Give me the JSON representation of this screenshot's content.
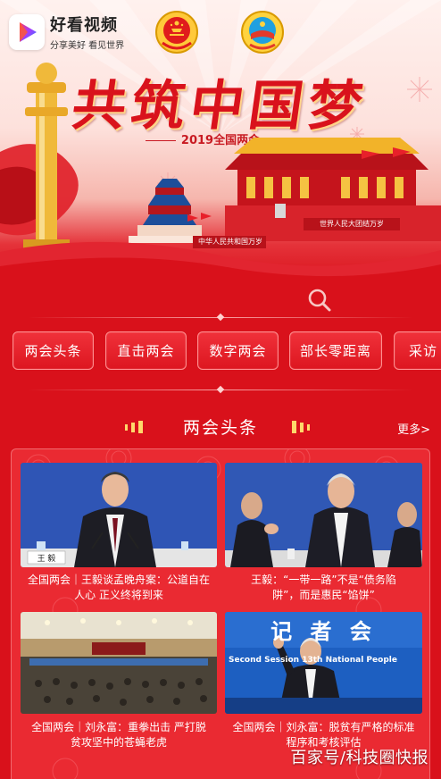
{
  "brand": {
    "name": "好看视频",
    "slogan": "分享美好 看见世界"
  },
  "hero": {
    "title": "共筑中国梦",
    "subtitle": "2019全国两会",
    "banner_left": "中华人民共和国万岁",
    "banner_right": "世界人民大团结万岁"
  },
  "search": {
    "icon": "search-icon"
  },
  "tabs": [
    {
      "label": "两会头条"
    },
    {
      "label": "直击两会"
    },
    {
      "label": "数字两会"
    },
    {
      "label": "部长零距离"
    },
    {
      "label": "采访"
    }
  ],
  "section": {
    "title": "两会头条",
    "more": "更多>"
  },
  "news": [
    {
      "caption_line1": "全国两会｜王毅谈孟晚舟案：公道自在",
      "caption_line2": "人心 正义终将到来",
      "nameplate": "王 毅"
    },
    {
      "caption_line1": "王毅：“一带一路”不是“债务陷",
      "caption_line2": "阱”，而是惠民“馅饼”"
    },
    {
      "caption_line1": "全国两会｜刘永富：重拳出击 严打脱",
      "caption_line2": "贫攻坚中的苍蝇老虎"
    },
    {
      "caption_line1": "全国两会｜刘永富：脱贫有严格的标准",
      "caption_line2": "程序和考核评估",
      "backdrop_text": "记 者 会",
      "backdrop_line": "Second Session   13th National People"
    }
  ],
  "watermark": "百家号/科技圈快报",
  "colors": {
    "primary_red": "#d9111b",
    "panel_red": "#ea2a32",
    "gold": "#ffd86b"
  }
}
